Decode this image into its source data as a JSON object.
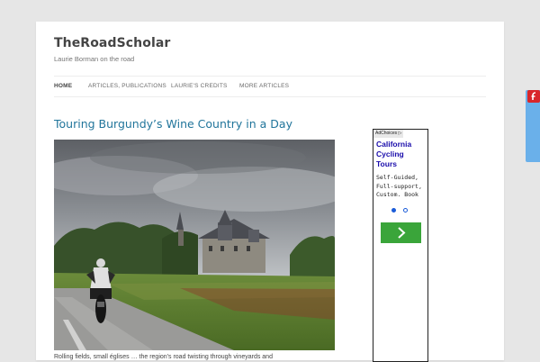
{
  "site": {
    "title": "TheRoadScholar",
    "description": "Laurie Borman on the road"
  },
  "nav": {
    "items": [
      {
        "label": "HOME"
      },
      {
        "label": "ARTICLES, PUBLICATIONS"
      },
      {
        "label": "LAURIE'S CREDITS"
      },
      {
        "label": "MORE ARTICLES"
      }
    ]
  },
  "post": {
    "title": "Touring Burgundy’s Wine Country in a Day",
    "teaser": "Rolling fields, small églises … the region's road twisting through vineyards and"
  },
  "ad": {
    "choices_label": "AdChoices",
    "title": "California Cycling Tours",
    "text": "Self-Guided, Full-support, Custom. Book",
    "go_icon": "chevron-right-icon"
  },
  "colors": {
    "link": "#21759b",
    "ad_button": "#3aa53a",
    "ad_title": "#1a0dab"
  },
  "icons": {
    "flash_plugin": "flash-icon",
    "ad_choices": "adchoices-icon"
  }
}
